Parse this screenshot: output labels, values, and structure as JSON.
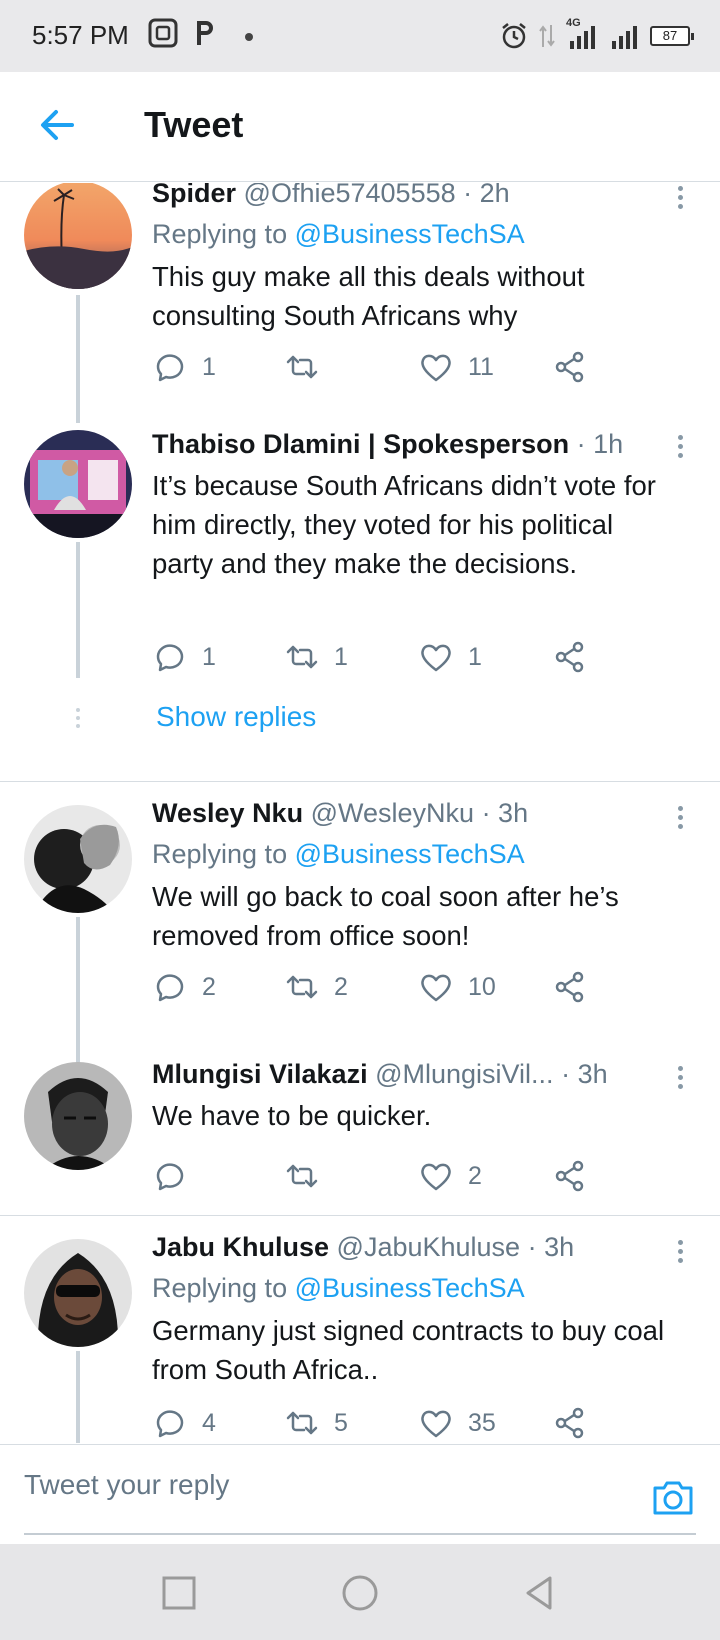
{
  "status_bar": {
    "time": "5:57 PM",
    "network": "4G",
    "battery": "87"
  },
  "header": {
    "title": "Tweet"
  },
  "tweets": [
    {
      "name": "Spider",
      "handle": "@Ofhie57405558",
      "time": "· 2h",
      "replying_prefix": "Replying to",
      "replying_to": "@BusinessTechSA",
      "text": "This guy make all this deals without consulting South Africans why",
      "replies": "1",
      "retweets": "",
      "likes": "11"
    },
    {
      "name": "Thabiso Dlamini | Spokesperson",
      "handle": "",
      "time": "· 1h",
      "text": "It’s because South Africans didn’t vote for him directly, they voted for his political party and they make the decisions.",
      "replies": "1",
      "retweets": "1",
      "likes": "1"
    },
    {
      "name": "Wesley Nku",
      "handle": "@WesleyNku",
      "time": "· 3h",
      "replying_prefix": "Replying to",
      "replying_to": "@BusinessTechSA",
      "text": "We will go back to coal soon after he’s removed from office soon!",
      "replies": "2",
      "retweets": "2",
      "likes": "10"
    },
    {
      "name": "Mlungisi Vilakazi",
      "handle": "@MlungisiVil...",
      "time": "· 3h",
      "text": "We have to be quicker.",
      "replies": "",
      "retweets": "",
      "likes": "2"
    },
    {
      "name": "Jabu Khuluse",
      "handle": "@JabuKhuluse",
      "time": "· 3h",
      "replying_prefix": "Replying to",
      "replying_to": "@BusinessTechSA",
      "text": "Germany just signed contracts to buy coal from South Africa..",
      "replies": "4",
      "retweets": "5",
      "likes": "35"
    }
  ],
  "show_replies": "Show replies",
  "reply_bar": {
    "placeholder": "Tweet your reply"
  },
  "colors": {
    "accent": "#1da1f2",
    "text": "#14171a",
    "muted": "#657786",
    "divider": "#d7dde2"
  },
  "icons": [
    "back-arrow-icon",
    "more-vertical-icon",
    "reply-icon",
    "retweet-icon",
    "like-icon",
    "share-icon",
    "camera-icon",
    "square-nav-icon",
    "circle-nav-icon",
    "triangle-back-nav-icon"
  ]
}
